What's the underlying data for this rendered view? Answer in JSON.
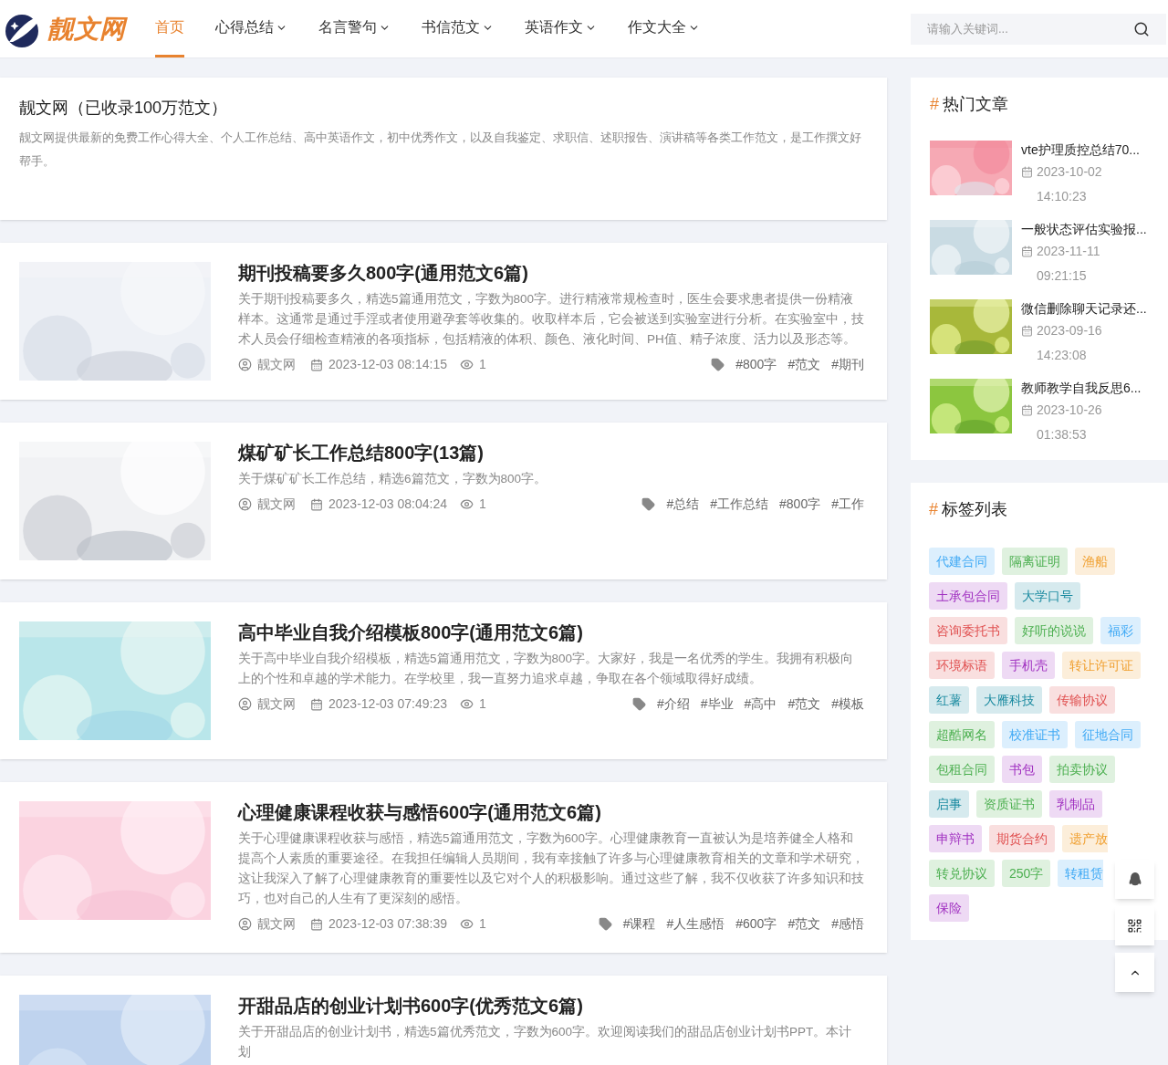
{
  "header": {
    "logo": "靓文网",
    "nav": [
      {
        "label": "首页",
        "selected": true,
        "dropdown": false
      },
      {
        "label": "心得总结",
        "selected": false,
        "dropdown": true
      },
      {
        "label": "名言警句",
        "selected": false,
        "dropdown": true
      },
      {
        "label": "书信范文",
        "selected": false,
        "dropdown": true
      },
      {
        "label": "英语作文",
        "selected": false,
        "dropdown": true
      },
      {
        "label": "作文大全",
        "selected": false,
        "dropdown": true
      }
    ],
    "search": {
      "placeholder": "请输入关键词..."
    }
  },
  "intro": {
    "title": "靓文网（已收录100万范文）",
    "text": "靓文网提供最新的免费工作心得大全、个人工作总结、高中英语作文，初中优秀作文，以及自我鉴定、求职信、述职报告、演讲稿等各类工作范文，是工作撰文好帮手。"
  },
  "articles": [
    {
      "title": "期刊投稿要多久800字(通用范文6篇)",
      "summary": "关于期刊投稿要多久，精选5篇通用范文，字数为800字。进行精液常规检查时，医生会要求患者提供一份精液样本。这通常是通过手淫或者使用避孕套等收集的。收取样本后，它会被送到实验室进行分析。在实验室中，技术人员会仔细检查精液的各项指标，包括精液的体积、颜色、液化时间、PH值、精子浓度、活力以及形态等。",
      "author": "靓文网",
      "date": "2023-12-03 08:14:15",
      "views": "1",
      "tags": [
        "#800字",
        "#范文",
        "#期刊"
      ]
    },
    {
      "title": "煤矿矿长工作总结800字(13篇)",
      "summary": "关于煤矿矿长工作总结，精选6篇范文，字数为800字。",
      "author": "靓文网",
      "date": "2023-12-03 08:04:24",
      "views": "1",
      "tags": [
        "#总结",
        "#工作总结",
        "#800字",
        "#工作"
      ]
    },
    {
      "title": "高中毕业自我介绍模板800字(通用范文6篇)",
      "summary": "关于高中毕业自我介绍模板，精选5篇通用范文，字数为800字。大家好，我是一名优秀的学生。我拥有积极向上的个性和卓越的学术能力。在学校里，我一直努力追求卓越，争取在各个领域取得好成绩。",
      "author": "靓文网",
      "date": "2023-12-03 07:49:23",
      "views": "1",
      "tags": [
        "#介绍",
        "#毕业",
        "#高中",
        "#范文",
        "#模板"
      ]
    },
    {
      "title": "心理健康课程收获与感悟600字(通用范文6篇)",
      "summary": "关于心理健康课程收获与感悟，精选5篇通用范文，字数为600字。心理健康教育一直被认为是培养健全人格和提高个人素质的重要途径。在我担任编辑人员期间，我有幸接触了许多与心理健康教育相关的文章和学术研究，这让我深入了解了心理健康教育的重要性以及它对个人的积极影响。通过这些了解，我不仅收获了许多知识和技巧，也对自己的人生有了更深刻的感悟。",
      "author": "靓文网",
      "date": "2023-12-03 07:38:39",
      "views": "1",
      "tags": [
        "#课程",
        "#人生感悟",
        "#600字",
        "#范文",
        "#感悟"
      ]
    },
    {
      "title": "开甜品店的创业计划书600字(优秀范文6篇)",
      "summary": "关于开甜品店的创业计划书，精选5篇优秀范文，字数为600字。欢迎阅读我们的甜品店创业计划书PPT。本计划"
    }
  ],
  "hot": {
    "marker": "#",
    "heading": "热门文章",
    "items": [
      {
        "title": "vte护理质控总结70...",
        "time": "2023-10-02 14:10:23"
      },
      {
        "title": "一般状态评估实验报...",
        "time": "2023-11-11 09:21:15"
      },
      {
        "title": "微信删除聊天记录还...",
        "time": "2023-09-16 14:23:08"
      },
      {
        "title": "教师教学自我反思6...",
        "time": "2023-10-26 01:38:53"
      }
    ]
  },
  "tag_list": {
    "marker": "#",
    "heading": "标签列表",
    "tags": [
      {
        "label": "代建合同",
        "color": "#3fa9f5"
      },
      {
        "label": "隔离证明",
        "color": "#4caf50"
      },
      {
        "label": "渔船",
        "color": "#f0a030"
      },
      {
        "label": "土承包合同",
        "color": "#a030c0"
      },
      {
        "label": "大学口号",
        "color": "#1a8aa0"
      },
      {
        "label": "咨询委托书",
        "color": "#e05050"
      },
      {
        "label": "好听的说说",
        "color": "#4caf50"
      },
      {
        "label": "福彩",
        "color": "#3fa9f5"
      },
      {
        "label": "环境标语",
        "color": "#e05050"
      },
      {
        "label": "手机壳",
        "color": "#a030c0"
      },
      {
        "label": "转让许可证",
        "color": "#f0a030"
      },
      {
        "label": "红薯",
        "color": "#1a8aa0"
      },
      {
        "label": "大雁科技",
        "color": "#1a8aa0"
      },
      {
        "label": "传输协议",
        "color": "#e05050"
      },
      {
        "label": "超酷网名",
        "color": "#4caf50"
      },
      {
        "label": "校准证书",
        "color": "#3fa9f5"
      },
      {
        "label": "征地合同",
        "color": "#3fa9f5"
      },
      {
        "label": "包租合同",
        "color": "#4caf50"
      },
      {
        "label": "书包",
        "color": "#a030c0"
      },
      {
        "label": "拍卖协议",
        "color": "#4caf50"
      },
      {
        "label": "启事",
        "color": "#1a8aa0"
      },
      {
        "label": "资质证书",
        "color": "#4caf50"
      },
      {
        "label": "乳制品",
        "color": "#a030c0"
      },
      {
        "label": "申辩书",
        "color": "#a030c0"
      },
      {
        "label": "期货合约",
        "color": "#e05050"
      },
      {
        "label": "遗产放",
        "color": "#f0a030",
        "kind": "clipped"
      },
      {
        "label": "转兑协议",
        "color": "#4caf50"
      },
      {
        "label": "250字",
        "color": "#4caf50"
      },
      {
        "label": "转租赁",
        "color": "#3fa9f5",
        "kind": "clipped"
      },
      {
        "label": "保险",
        "color": "#a030c0"
      }
    ]
  }
}
